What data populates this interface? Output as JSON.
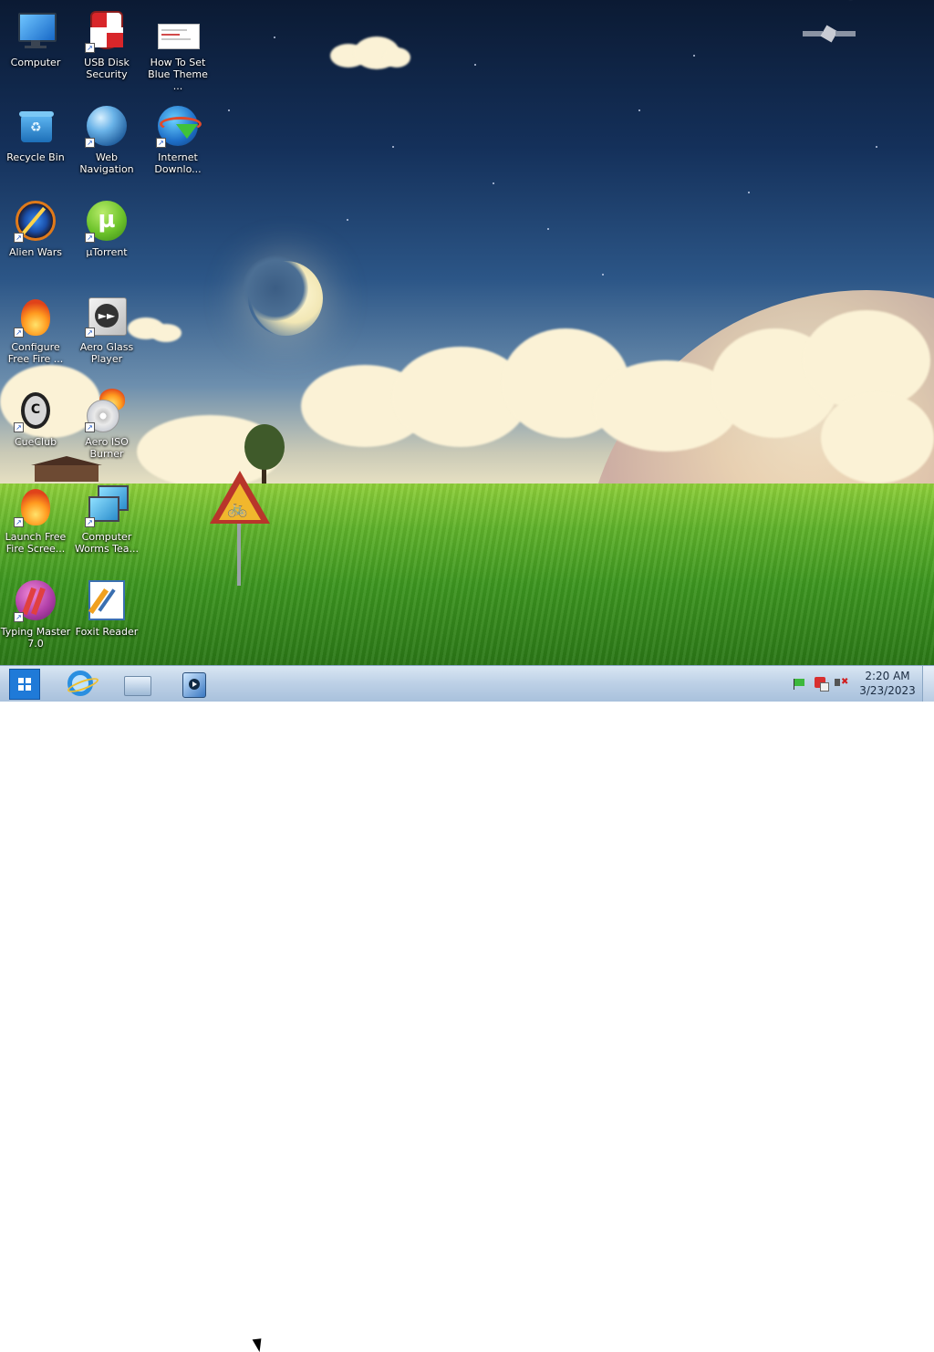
{
  "desktop": {
    "icons": [
      {
        "label": "Computer",
        "icon": "computer-icon"
      },
      {
        "label": "USB Disk Security",
        "icon": "shield-icon"
      },
      {
        "label": "How To Set Blue Theme ...",
        "icon": "document-icon"
      },
      {
        "label": "Recycle Bin",
        "icon": "recycle-bin-icon"
      },
      {
        "label": "Web Navigation",
        "icon": "globe-icon"
      },
      {
        "label": "Internet Downlo...",
        "icon": "download-manager-icon"
      },
      {
        "label": "Alien Wars",
        "icon": "game-icon"
      },
      {
        "label": "µTorrent",
        "icon": "utorrent-icon"
      },
      {
        "label": "Configure Free Fire ...",
        "icon": "fire-icon"
      },
      {
        "label": "Aero Glass Player",
        "icon": "media-player-icon"
      },
      {
        "label": "CueClub",
        "icon": "cueclub-icon"
      },
      {
        "label": "Aero ISO Burner",
        "icon": "disc-burner-icon"
      },
      {
        "label": "Launch Free Fire Scree...",
        "icon": "fire-icon"
      },
      {
        "label": "Computer Worms Tea...",
        "icon": "monitors-icon"
      },
      {
        "label": "Typing Master 7.0",
        "icon": "typing-master-icon"
      },
      {
        "label": "Foxit Reader",
        "icon": "foxit-reader-icon"
      }
    ]
  },
  "taskbar": {
    "pinned": [
      {
        "name": "start-button",
        "icon": "windows-logo-icon"
      },
      {
        "name": "internet-explorer",
        "icon": "internet-explorer-icon"
      },
      {
        "name": "file-explorer",
        "icon": "folder-icon"
      },
      {
        "name": "media-player",
        "icon": "media-player-icon"
      }
    ],
    "tray": [
      "flag-icon",
      "security-icon",
      "volume-muted-icon"
    ],
    "clock": {
      "time": "2:20 AM",
      "date": "3/23/2023"
    }
  },
  "colors": {
    "taskbar_top": "#d9e6f3",
    "taskbar_bottom": "#a9c1dc",
    "start_blue": "#1f7ad8",
    "label_text": "#ffffff"
  }
}
